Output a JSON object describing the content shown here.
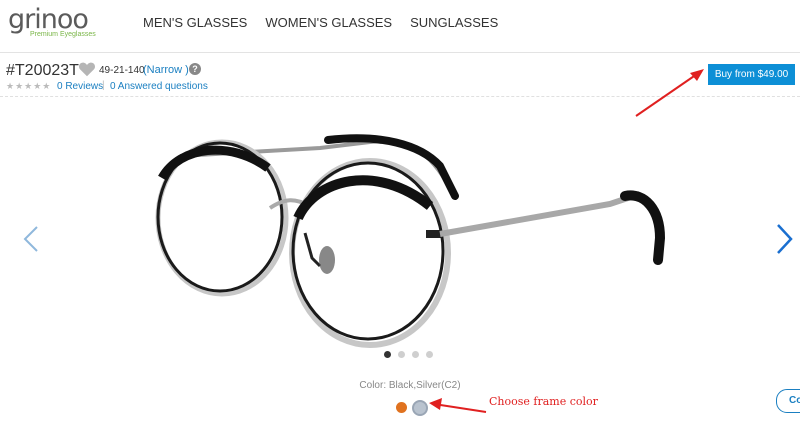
{
  "logo": {
    "word": "grinoo",
    "tagline": "Premium Eyeglasses"
  },
  "nav": [
    "MEN'S GLASSES",
    "WOMEN'S GLASSES",
    "SUNGLASSES"
  ],
  "product": {
    "sku": "#T20023T",
    "sizes": "49-21-140",
    "fit": "(Narrow )",
    "help": "?",
    "stars": "★★★★★",
    "reviews": "0 Reviews",
    "separator": "|",
    "answered": "0 Answered questions",
    "buy_label": "Buy from $49.00",
    "color_label": "Color: Black,Silver(C2)",
    "swatches": [
      {
        "color": "#e0721f"
      },
      {
        "color": "#b9c3cf",
        "selected": true
      }
    ],
    "carousel_active": 0
  },
  "annotation": {
    "text": "Choose frame color",
    "color": "#e02020"
  },
  "partial_button": "Co",
  "colors": {
    "accent": "#0d8fd6",
    "link": "#1a7fc1"
  }
}
